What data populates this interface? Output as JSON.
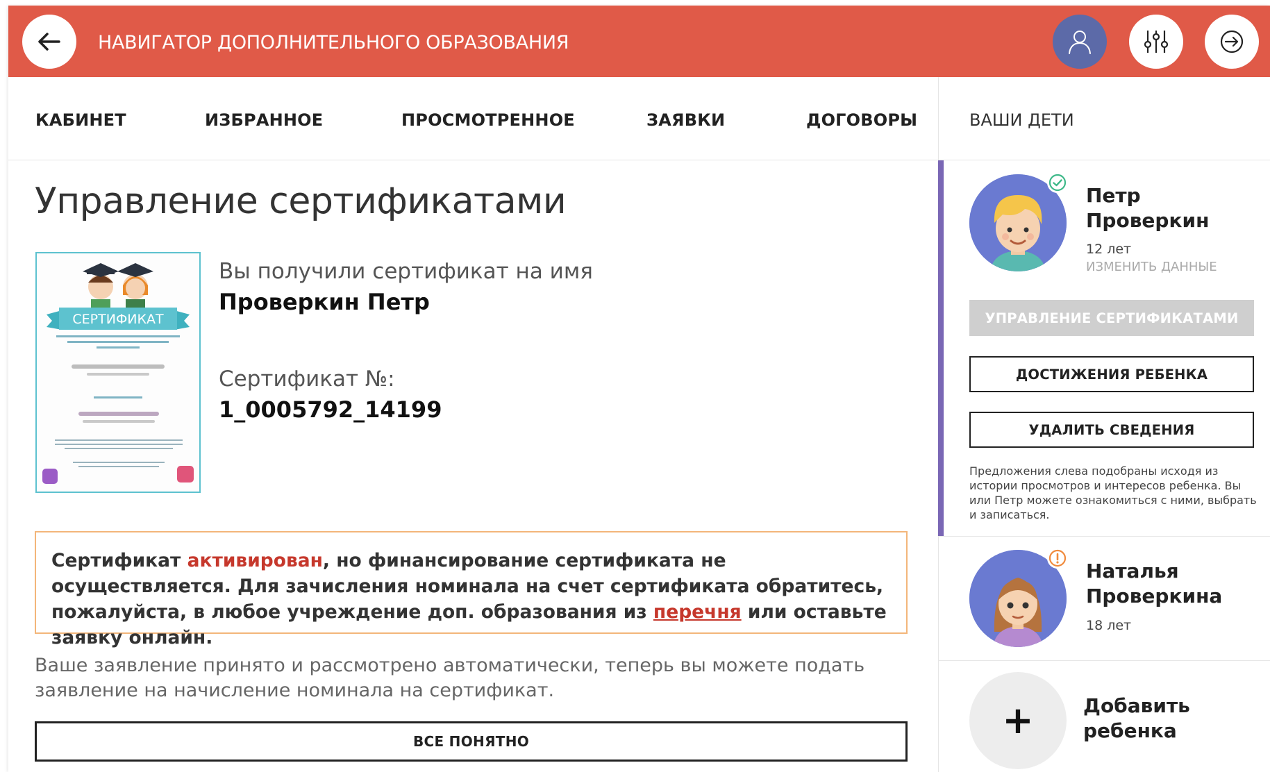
{
  "header": {
    "title": "НАВИГАТОР ДОПОЛНИТЕЛЬНОГО ОБРАЗОВАНИЯ",
    "colors": {
      "background": "#e05a48",
      "user_button": "#5c6aa8"
    }
  },
  "nav": {
    "tabs": [
      {
        "label": "КАБИНЕТ"
      },
      {
        "label": "ИЗБРАННОЕ"
      },
      {
        "label": "ПРОСМОТРЕННОЕ"
      },
      {
        "label": "ЗАЯВКИ"
      },
      {
        "label": "ДОГОВОРЫ"
      }
    ]
  },
  "main": {
    "title": "Управление сертификатами",
    "certificate": {
      "received_label": "Вы получили сертификат на имя",
      "owner_name": "Проверкин Петр",
      "number_label": "Сертификат №:",
      "number": "1_0005792_14199",
      "thumbnail_banner": "СЕРТИФИКАТ"
    },
    "notice": {
      "part1": "Сертификат ",
      "accent": "активирован",
      "part2": ", но финансирование сертификата не осуществляется. Для зачисления номинала на счет сертификата обратитесь, пожалуйста, в любое учреждение доп. образования из ",
      "link": "перечня",
      "part3": " или оставьте заявку онлайн."
    },
    "status_text": "Ваше заявление принято и рассмотрено автоматически, теперь вы можете подать заявление на начисление номинала на сертификат.",
    "ok_button": "ВСЕ ПОНЯТНО"
  },
  "sidebar": {
    "title": "ВАШИ ДЕТИ",
    "children": [
      {
        "first_name": "Петр",
        "last_name": "Проверкин",
        "age": "12 лет",
        "edit_link": "ИЗМЕНИТЬ ДАННЫЕ",
        "status": "check",
        "buttons": {
          "manage": "УПРАВЛЕНИЕ СЕРТИФИКАТАМИ",
          "achievements": "ДОСТИЖЕНИЯ РЕБЕНКА",
          "delete": "УДАЛИТЬ СВЕДЕНИЯ"
        },
        "note": "Предложения слева подобраны исходя из истории просмотров и интересов ребенка. Вы или Петр можете ознакомиться с ними, выбрать и записаться."
      },
      {
        "first_name": "Наталья",
        "last_name": "Проверкина",
        "age": "18 лет",
        "status": "warning"
      }
    ],
    "add_child": {
      "label": "Добавить ребенка"
    },
    "colors": {
      "active_bar": "#7a67b5",
      "check": "#3fb98a",
      "warning": "#f08a3c"
    }
  }
}
